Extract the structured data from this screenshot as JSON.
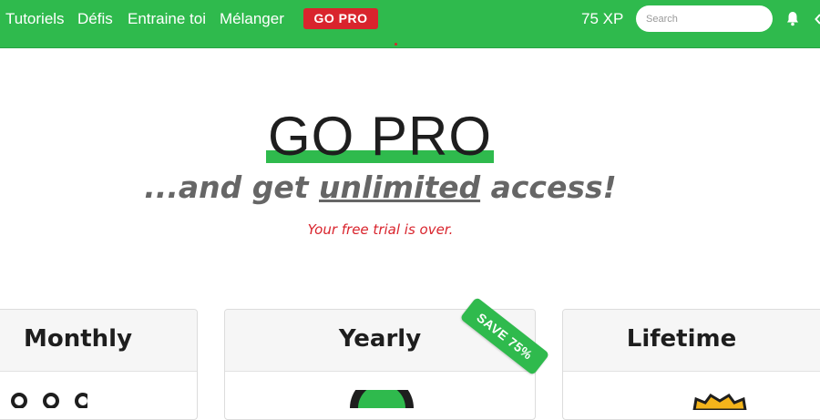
{
  "nav": {
    "links": [
      "Tutoriels",
      "Défis",
      "Entraine toi",
      "Mélanger"
    ],
    "gopro_label": "GO PRO",
    "xp": "75 XP",
    "search_placeholder": "Search",
    "icons": [
      "bell-icon",
      "chevron-icon"
    ]
  },
  "hero": {
    "title": "GO PRO",
    "tagline_pre": "...and get ",
    "tagline_emph": "unlimited",
    "tagline_post": " access!",
    "trial_notice": "Your free trial is over."
  },
  "plans": [
    {
      "title": "Monthly",
      "icon": "dots-icon"
    },
    {
      "title": "Yearly",
      "icon": "badge-icon",
      "ribbon": "SAVE 75%"
    },
    {
      "title": "Lifetime",
      "icon": "crown-icon"
    }
  ],
  "colors": {
    "brand_green": "#2fba4d",
    "accent_red": "#d9242d",
    "text_dark": "#1e1e1e",
    "text_gray": "#666666"
  }
}
